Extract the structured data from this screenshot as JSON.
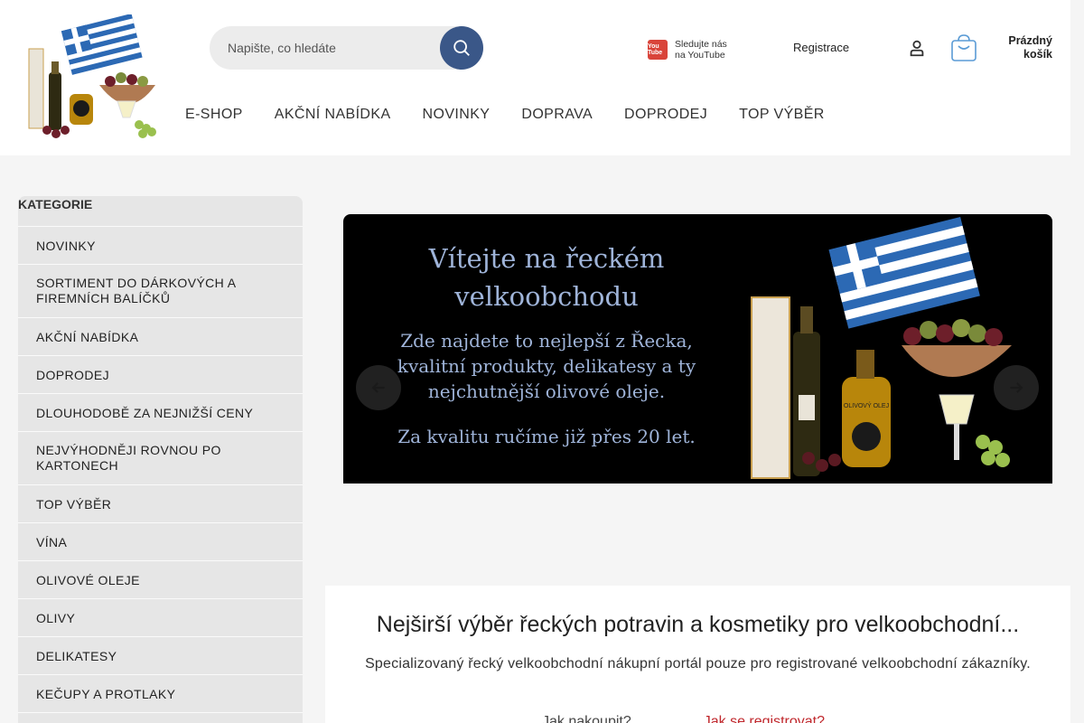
{
  "header": {
    "search_placeholder": "Napište, co hledáte",
    "youtube_line1": "Sledujte nás",
    "youtube_line2": "na YouTube",
    "youtube_logo": "You Tube",
    "registrace": "Registrace",
    "cart_line1": "Prázdný",
    "cart_line2": "košík"
  },
  "nav": [
    "E-SHOP",
    "AKČNÍ NABÍDKA",
    "NOVINKY",
    "DOPRAVA",
    "DOPRODEJ",
    "TOP VÝBĚR"
  ],
  "sidebar": {
    "title": "KATEGORIE",
    "items": [
      "NOVINKY",
      "SORTIMENT DO DÁRKOVÝCH A FIREMNÍCH BALÍČKŮ",
      "AKČNÍ NABÍDKA",
      "DOPRODEJ",
      "DLOUHODOBĚ ZA NEJNIŽŠÍ CENY",
      "NEJVÝHODNĚJI ROVNOU PO KARTONECH",
      "TOP VÝBĚR",
      "VÍNA",
      "OLIVOVÉ OLEJE",
      "OLIVY",
      "DELIKATESY",
      "KEČUPY A PROTLAKY"
    ]
  },
  "banner": {
    "title_line1": "Vítejte na řeckém",
    "title_line2": "velkoobchodu",
    "sub_line1": "Zde najdete to nejlepší z Řecka,",
    "sub_line2": "kvalitní produkty, delikatesy a ty",
    "sub_line3": "nejchutnější olivové oleje.",
    "footer": "Za kvalitu ručíme již přes 20 let.",
    "bottle_label": "OLIVOVÝ OLEJ"
  },
  "content": {
    "heading": "Nejširší výběr řeckých potravin a kosmetiky pro velkoobchodní...",
    "subheading": "Specializovaný řecký velkoobchodní nákupní portál pouze pro registrované velkoobchodní zákazníky.",
    "link_1": "Jak nakoupit?",
    "link_2": "Jak se registrovat?"
  },
  "colors": {
    "accent_blue": "#3a5788",
    "youtube_red": "#d9443a",
    "link_red": "#c0282d",
    "banner_text": "#9fb4d9"
  }
}
